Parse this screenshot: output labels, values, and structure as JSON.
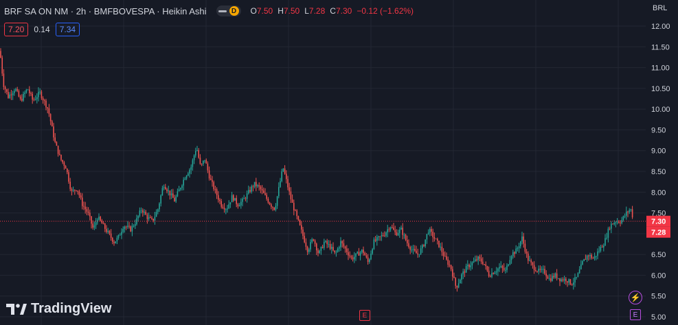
{
  "header": {
    "symbol": "BRF SA ON NM · 2h · BMFBOVESPA · Heikin Ashi",
    "pill_letter": "D",
    "ohlc": [
      {
        "key": "O",
        "value": "7.50"
      },
      {
        "key": "H",
        "value": "7.50"
      },
      {
        "key": "L",
        "value": "7.28"
      },
      {
        "key": "C",
        "value": "7.30"
      }
    ],
    "change": "−0.12 (−1.62%)"
  },
  "indicator": {
    "bid": "7.20",
    "spread": "0.14",
    "ask": "7.34"
  },
  "currency": "BRL",
  "logo_text": "TradingView",
  "event_label": "E",
  "colors": {
    "background": "#161a25",
    "grid": "#232733",
    "up": "#26a69a",
    "down": "#ef5350",
    "price_line": "#f23645",
    "axis_text": "#d1d4dc"
  },
  "chart_data": {
    "type": "candlestick",
    "style": "Heikin Ashi",
    "y_axis": {
      "ticks": [
        "12.00",
        "11.50",
        "11.00",
        "10.50",
        "10.00",
        "9.50",
        "9.00",
        "8.50",
        "8.00",
        "7.50",
        "7.00",
        "6.50",
        "6.00",
        "5.50",
        "5.00"
      ],
      "ylim": [
        5.0,
        12.0
      ],
      "position": "right"
    },
    "price_labels": [
      {
        "value": 7.3,
        "text": "7.30"
      },
      {
        "value": 7.28,
        "text": "7.28"
      }
    ],
    "close_path": [
      [
        0,
        11.4
      ],
      [
        5,
        10.6
      ],
      [
        12,
        10.3
      ],
      [
        22,
        10.5
      ],
      [
        30,
        10.2
      ],
      [
        40,
        10.5
      ],
      [
        48,
        10.2
      ],
      [
        58,
        10.4
      ],
      [
        70,
        10.0
      ],
      [
        80,
        9.2
      ],
      [
        88,
        8.8
      ],
      [
        96,
        8.6
      ],
      [
        104,
        8.0
      ],
      [
        112,
        8.1
      ],
      [
        120,
        7.7
      ],
      [
        128,
        7.5
      ],
      [
        136,
        7.1
      ],
      [
        142,
        7.4
      ],
      [
        150,
        7.2
      ],
      [
        158,
        7.0
      ],
      [
        166,
        6.8
      ],
      [
        172,
        6.9
      ],
      [
        180,
        7.2
      ],
      [
        190,
        7.1
      ],
      [
        198,
        7.3
      ],
      [
        206,
        7.6
      ],
      [
        214,
        7.4
      ],
      [
        222,
        7.3
      ],
      [
        230,
        7.6
      ],
      [
        238,
        8.2
      ],
      [
        246,
        8.0
      ],
      [
        254,
        7.8
      ],
      [
        262,
        8.1
      ],
      [
        270,
        8.4
      ],
      [
        278,
        8.6
      ],
      [
        286,
        9.1
      ],
      [
        292,
        8.6
      ],
      [
        298,
        8.8
      ],
      [
        306,
        8.3
      ],
      [
        314,
        8.0
      ],
      [
        322,
        7.7
      ],
      [
        330,
        7.6
      ],
      [
        338,
        7.9
      ],
      [
        346,
        7.7
      ],
      [
        354,
        7.8
      ],
      [
        362,
        8.0
      ],
      [
        370,
        8.2
      ],
      [
        378,
        8.1
      ],
      [
        386,
        7.9
      ],
      [
        394,
        7.7
      ],
      [
        400,
        7.6
      ],
      [
        406,
        8.1
      ],
      [
        412,
        8.6
      ],
      [
        418,
        8.2
      ],
      [
        424,
        7.8
      ],
      [
        432,
        7.4
      ],
      [
        440,
        7.0
      ],
      [
        448,
        6.6
      ],
      [
        456,
        6.9
      ],
      [
        464,
        6.5
      ],
      [
        472,
        6.8
      ],
      [
        480,
        6.7
      ],
      [
        488,
        6.5
      ],
      [
        496,
        6.8
      ],
      [
        504,
        6.6
      ],
      [
        512,
        6.4
      ],
      [
        520,
        6.5
      ],
      [
        528,
        6.6
      ],
      [
        536,
        6.3
      ],
      [
        544,
        6.8
      ],
      [
        552,
        6.9
      ],
      [
        560,
        7.0
      ],
      [
        568,
        7.2
      ],
      [
        576,
        7.0
      ],
      [
        584,
        7.1
      ],
      [
        592,
        6.8
      ],
      [
        600,
        6.6
      ],
      [
        608,
        6.5
      ],
      [
        616,
        6.7
      ],
      [
        624,
        7.1
      ],
      [
        632,
        6.9
      ],
      [
        640,
        6.7
      ],
      [
        648,
        6.4
      ],
      [
        656,
        6.2
      ],
      [
        664,
        5.7
      ],
      [
        672,
        6.0
      ],
      [
        680,
        6.2
      ],
      [
        688,
        6.3
      ],
      [
        696,
        6.4
      ],
      [
        704,
        6.3
      ],
      [
        712,
        6.0
      ],
      [
        720,
        6.1
      ],
      [
        728,
        6.2
      ],
      [
        736,
        6.1
      ],
      [
        744,
        6.5
      ],
      [
        752,
        6.6
      ],
      [
        760,
        6.9
      ],
      [
        768,
        6.4
      ],
      [
        776,
        6.2
      ],
      [
        784,
        6.1
      ],
      [
        792,
        6.1
      ],
      [
        800,
        5.9
      ],
      [
        808,
        6.0
      ],
      [
        816,
        5.9
      ],
      [
        824,
        5.9
      ],
      [
        832,
        5.8
      ],
      [
        840,
        5.95
      ],
      [
        848,
        6.3
      ],
      [
        856,
        6.5
      ],
      [
        864,
        6.4
      ],
      [
        872,
        6.6
      ],
      [
        880,
        6.8
      ],
      [
        888,
        7.2
      ],
      [
        896,
        7.3
      ],
      [
        904,
        7.3
      ],
      [
        912,
        7.5
      ],
      [
        918,
        7.6
      ],
      [
        922,
        7.35
      ]
    ]
  }
}
